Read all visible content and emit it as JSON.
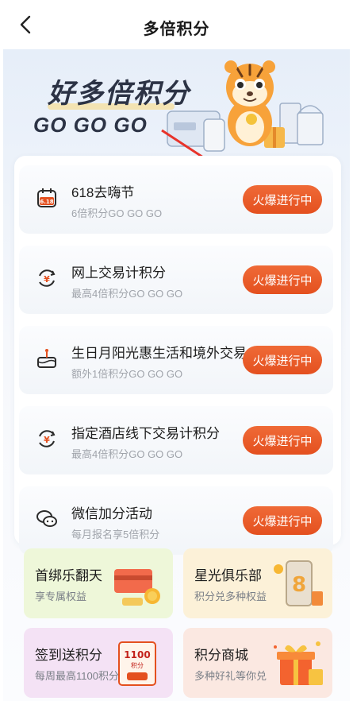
{
  "nav": {
    "title": "多倍积分",
    "back_icon": "chevron-left-icon"
  },
  "hero": {
    "title": "好多倍积分",
    "subtitle": "GO GO GO"
  },
  "activities": [
    {
      "icon": "calendar-618-icon",
      "title": "618去嗨节",
      "desc": "6倍积分GO GO GO",
      "button": "火爆进行中"
    },
    {
      "icon": "exchange-yuan-icon",
      "title": "网上交易计积分",
      "desc": "最高4倍积分GO GO GO",
      "button": "火爆进行中"
    },
    {
      "icon": "birthday-cake-icon",
      "title": "生日月阳光惠生活和境外交易",
      "desc": "额外1倍积分GO GO GO",
      "button": "火爆进行中"
    },
    {
      "icon": "exchange-yuan-icon",
      "title": "指定酒店线下交易计积分",
      "desc": "最高4倍积分GO GO GO",
      "button": "火爆进行中"
    },
    {
      "icon": "wechat-icon",
      "title": "微信加分活动",
      "desc": "每月报名享5倍积分",
      "button": "火爆进行中"
    }
  ],
  "tiles": [
    {
      "title": "首绑乐翻天",
      "desc": "享专属权益",
      "bg": "#eef7d9",
      "art": "card-coins-icon"
    },
    {
      "title": "星光俱乐部",
      "desc": "积分兑多种权益",
      "bg": "#fcf1d8",
      "art": "phone-8-icon"
    },
    {
      "title": "签到送积分",
      "desc": "每周最高1100积分",
      "bg": "#f4e2f5",
      "art": "coupon-1100-icon",
      "art_text": "1100",
      "art_sub": "积分"
    },
    {
      "title": "积分商城",
      "desc": "多种好礼等你兑",
      "bg": "#fbe8e1",
      "art": "gift-boxes-icon"
    }
  ]
}
